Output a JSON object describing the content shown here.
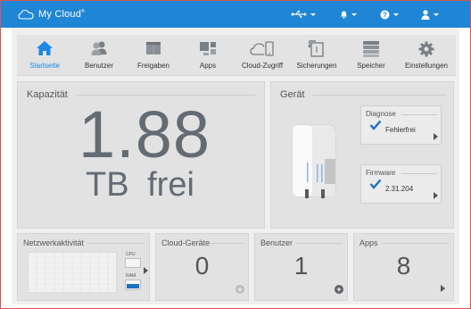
{
  "app": {
    "title": "My Cloud",
    "trademark": "®"
  },
  "topbar": {
    "icons": [
      "usb-icon",
      "bell-icon",
      "help-icon",
      "user-icon"
    ]
  },
  "nav": {
    "items": [
      {
        "label": "Startseite",
        "icon": "home-icon",
        "active": true
      },
      {
        "label": "Benutzer",
        "icon": "users-icon",
        "active": false
      },
      {
        "label": "Freigaben",
        "icon": "folder-icon",
        "active": false
      },
      {
        "label": "Apps",
        "icon": "apps-icon",
        "active": false
      },
      {
        "label": "Cloud-Zugriff",
        "icon": "cloud-access-icon",
        "active": false
      },
      {
        "label": "Sicherungen",
        "icon": "backup-icon",
        "active": false
      },
      {
        "label": "Speicher",
        "icon": "storage-icon",
        "active": false
      },
      {
        "label": "Einstellungen",
        "icon": "gear-icon",
        "active": false
      }
    ]
  },
  "capacity": {
    "title": "Kapazität",
    "value": "1.88",
    "unit": "TB frei"
  },
  "device": {
    "title": "Gerät",
    "diagnosis": {
      "title": "Diagnose",
      "value": "Fehlerfrei"
    },
    "firmware": {
      "title": "Firmware",
      "value": "2.31.204"
    }
  },
  "network": {
    "title": "Netzwerkaktivität",
    "cpu_label": "CPU",
    "ram_label": "RAM"
  },
  "cloud_devices": {
    "title": "Cloud-Geräte",
    "count": "0"
  },
  "users": {
    "title": "Benutzer",
    "count": "1"
  },
  "apps": {
    "title": "Apps",
    "count": "8"
  },
  "colors": {
    "accent": "#1f86d6",
    "check": "#1e6fc0",
    "ram_bar": "#1e6fc0"
  }
}
